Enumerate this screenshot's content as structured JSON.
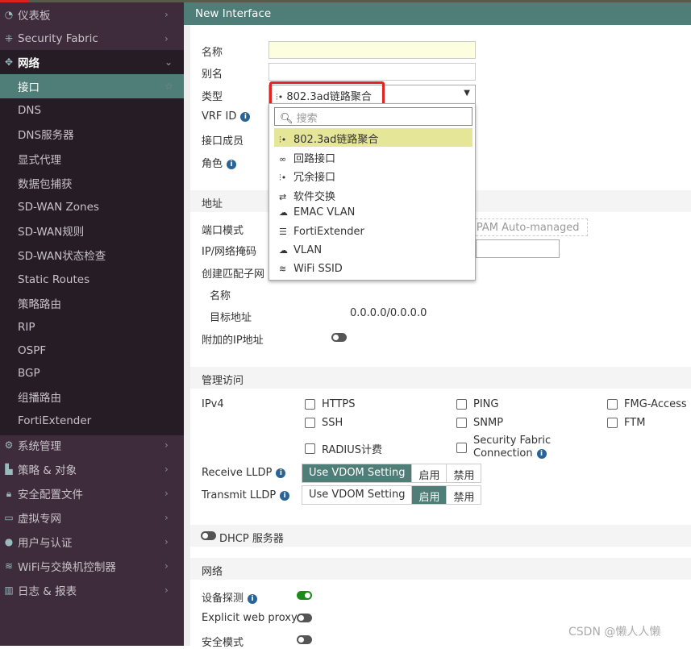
{
  "sidebar": {
    "items": [
      {
        "label": "仪表板",
        "icon": "dashboard-icon"
      },
      {
        "label": "Security Fabric",
        "icon": "fabric-icon"
      },
      {
        "label": "网络",
        "icon": "network-icon"
      },
      {
        "label": "接口"
      },
      {
        "label": "DNS"
      },
      {
        "label": "DNS服务器"
      },
      {
        "label": "显式代理"
      },
      {
        "label": "数据包捕获"
      },
      {
        "label": "SD-WAN Zones"
      },
      {
        "label": "SD-WAN规则"
      },
      {
        "label": "SD-WAN状态检查"
      },
      {
        "label": "Static Routes"
      },
      {
        "label": "策略路由"
      },
      {
        "label": "RIP"
      },
      {
        "label": "OSPF"
      },
      {
        "label": "BGP"
      },
      {
        "label": "组播路由"
      },
      {
        "label": "FortiExtender"
      },
      {
        "label": "系统管理",
        "icon": "gear-icon"
      },
      {
        "label": "策略 & 对象",
        "icon": "policy-icon"
      },
      {
        "label": "安全配置文件",
        "icon": "lock-icon"
      },
      {
        "label": "虚拟专网",
        "icon": "laptop-icon"
      },
      {
        "label": "用户与认证",
        "icon": "user-icon"
      },
      {
        "label": "WiFi与交换机控制器",
        "icon": "wifi-icon"
      },
      {
        "label": "日志 & 报表",
        "icon": "chart-icon"
      }
    ]
  },
  "header": {
    "title": "New Interface"
  },
  "form": {
    "name_label": "名称",
    "alias_label": "别名",
    "type_label": "类型",
    "type_value": "802.3ad链路聚合",
    "vrf_label": "VRF ID",
    "members_label": "接口成员",
    "role_label": "角色",
    "search_placeholder": "搜索",
    "options": [
      {
        "label": "802.3ad链路聚合",
        "icon": "aggregate-icon",
        "selected": true
      },
      {
        "label": "回路接口",
        "icon": "loopback-icon"
      },
      {
        "label": "冗余接口",
        "icon": "redundant-icon"
      },
      {
        "label": "软件交换",
        "icon": "shuffle-icon"
      },
      {
        "label": "EMAC VLAN",
        "icon": "cloud-icon"
      },
      {
        "label": "FortiExtender",
        "icon": "extender-icon"
      },
      {
        "label": "VLAN",
        "icon": "cloud-icon"
      },
      {
        "label": "WiFi SSID",
        "icon": "wifi-icon"
      }
    ]
  },
  "address": {
    "title": "地址",
    "mode_label": "端口模式",
    "ipam": "IPAM Auto-managed",
    "ip_label": "IP/网络掩码",
    "subnet_label": "创建匹配子网",
    "name_label": "名称",
    "dest_label": "目标地址",
    "dest_value": "0.0.0.0/0.0.0.0",
    "extra_ip_label": "附加的IP地址"
  },
  "admin": {
    "title": "管理访问",
    "ipv4_label": "IPv4",
    "checks": [
      "HTTPS",
      "PING",
      "FMG-Access",
      "SSH",
      "SNMP",
      "FTM",
      "RADIUS计费",
      "Security Fabric",
      "Connection"
    ],
    "rx_label": "Receive LLDP",
    "tx_label": "Transmit LLDP",
    "seg": [
      "Use VDOM Setting",
      "启用",
      "禁用"
    ],
    "rx_selected": "Use VDOM Setting",
    "tx_selected": "启用"
  },
  "dhcp": {
    "label": "DHCP 服务器",
    "enabled": false
  },
  "network": {
    "title": "网络",
    "device_detect": "设备探测",
    "device_detect_on": true,
    "proxy": "Explicit web proxy",
    "proxy_on": false,
    "secure": "安全模式",
    "secure_on": false
  },
  "watermark": "CSDN @懒人人懒",
  "colors": {
    "sidebar": "#3e2b3c",
    "accent": "#4f7d78",
    "highlight": "#e6e699",
    "toggle_on": "#1a8a1a"
  }
}
